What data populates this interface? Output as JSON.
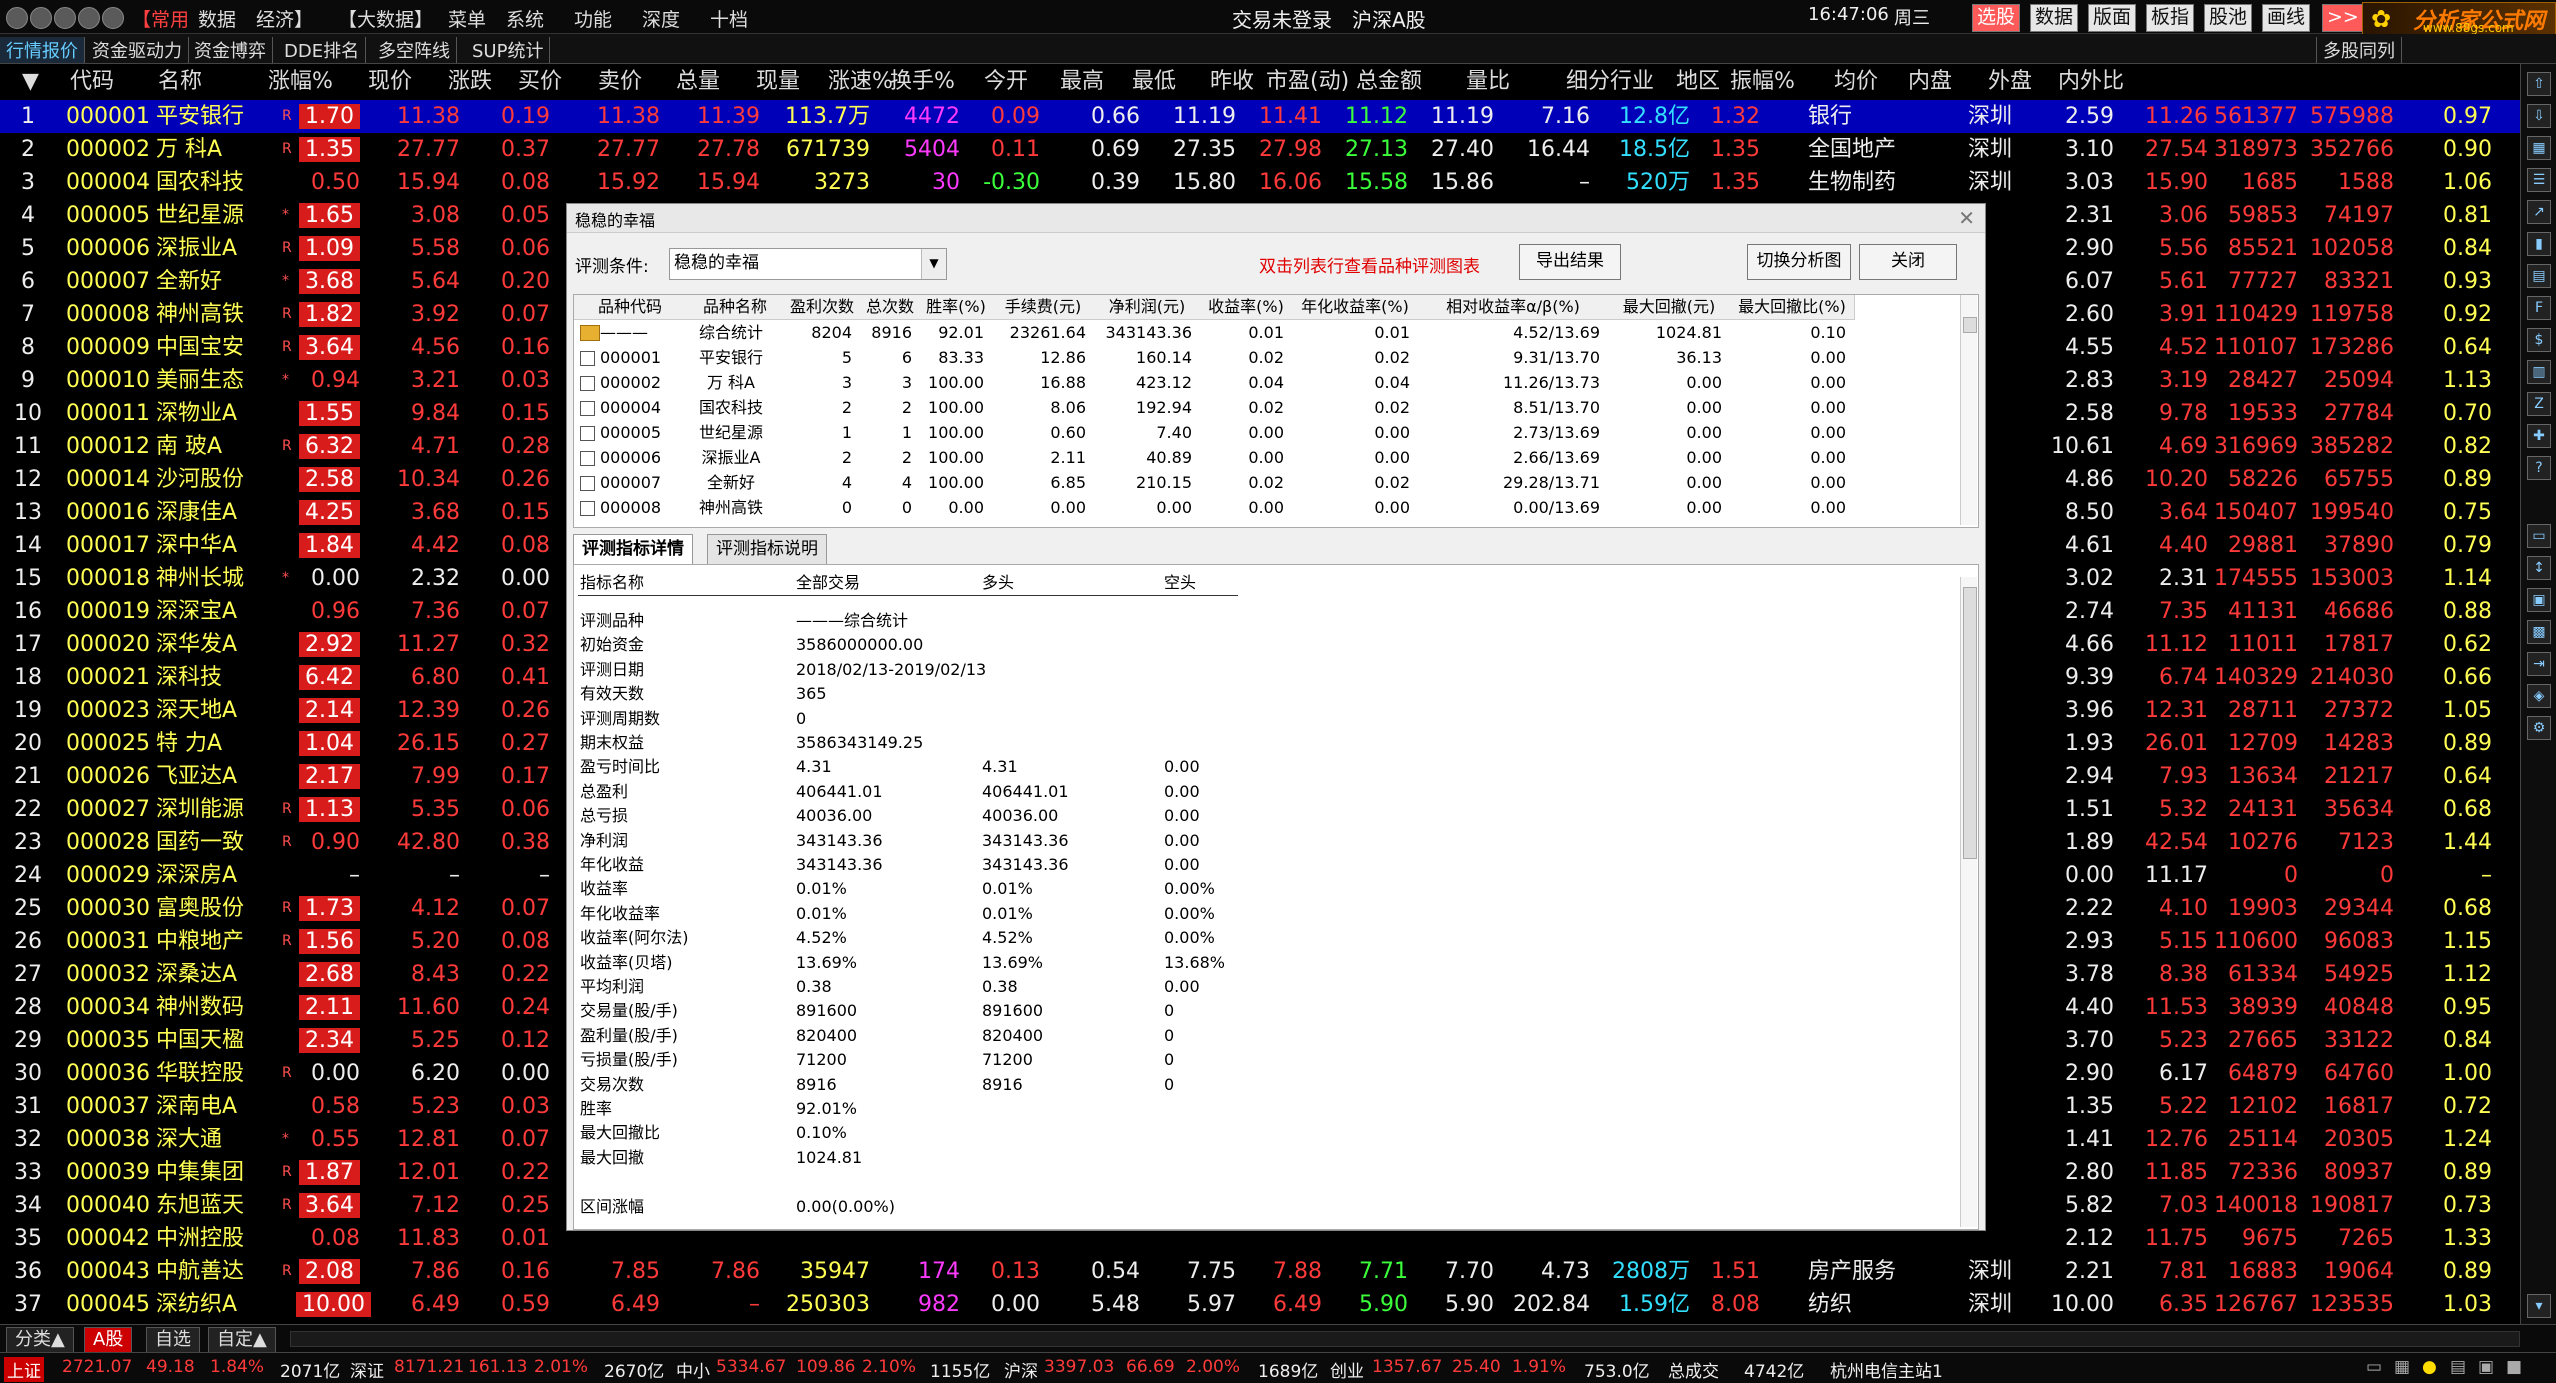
{
  "menu": {
    "items": [
      "【常用",
      "数据",
      "经济】",
      "【大数据】",
      "菜单",
      "系统",
      "功能",
      "深度",
      "十档"
    ],
    "status": "交易未登录",
    "market": "沪深A股",
    "time": "16:47:06",
    "weekday": "周三",
    "buttons": [
      "选股",
      "数据",
      "版面",
      "板指",
      "股池",
      "画线",
      ">>"
    ],
    "logo_text": "分析家公式网",
    "logo_url": "www.88gs.com"
  },
  "tabs": [
    "行情报价",
    "资金驱动力",
    "资金博弈",
    "DDE排名",
    "多空阵线",
    "SUP统计"
  ],
  "right_tabs": [
    "多股同列"
  ],
  "columns": [
    "代码",
    "名称",
    "涨幅%",
    "现价",
    "涨跌",
    "买价",
    "卖价",
    "总量",
    "现量",
    "涨速%",
    "换手%",
    "今开",
    "最高",
    "最低",
    "昨收",
    "市盈(动)",
    "总金额",
    "量比",
    "细分行业",
    "地区",
    "振幅%",
    "均价",
    "内盘",
    "外盘",
    "内外比"
  ],
  "rows": [
    [
      "1",
      "000001",
      "平安银行",
      "R",
      "1.70",
      "11.38",
      "0.19",
      "11.38",
      "11.39",
      "113.7万",
      "4472",
      "0.09",
      "0.66",
      "11.19",
      "11.41",
      "11.12",
      "11.19",
      "7.16",
      "12.8亿",
      "1.32",
      "银行",
      "深圳",
      "2.59",
      "11.26",
      "561377",
      "575988",
      "0.97"
    ],
    [
      "2",
      "000002",
      "万 科A",
      "R",
      "1.35",
      "27.77",
      "0.37",
      "27.77",
      "27.78",
      "671739",
      "5404",
      "0.11",
      "0.69",
      "27.35",
      "27.98",
      "27.13",
      "27.40",
      "16.44",
      "18.5亿",
      "1.35",
      "全国地产",
      "深圳",
      "3.10",
      "27.54",
      "318973",
      "352766",
      "0.90"
    ],
    [
      "3",
      "000004",
      "国农科技",
      "",
      "0.50",
      "15.94",
      "0.08",
      "15.92",
      "15.94",
      "3273",
      "30",
      "-0.30",
      "0.39",
      "15.80",
      "16.06",
      "15.58",
      "15.86",
      "–",
      "520万",
      "1.35",
      "生物制药",
      "深圳",
      "3.03",
      "15.90",
      "1685",
      "1588",
      "1.06"
    ],
    [
      "4",
      "000005",
      "世纪星源",
      "*",
      "1.65",
      "3.08",
      "0.05",
      "",
      "",
      "",
      "",
      "",
      "",
      "",
      "",
      "",
      "",
      "",
      "",
      "",
      "",
      "",
      "2.31",
      "3.06",
      "59853",
      "74197",
      "0.81"
    ],
    [
      "5",
      "000006",
      "深振业A",
      "R",
      "1.09",
      "5.58",
      "0.06",
      "",
      "",
      "",
      "",
      "",
      "",
      "",
      "",
      "",
      "",
      "",
      "",
      "",
      "",
      "",
      "2.90",
      "5.56",
      "85521",
      "102058",
      "0.84"
    ],
    [
      "6",
      "000007",
      "全新好",
      "*",
      "3.68",
      "5.64",
      "0.20",
      "",
      "",
      "",
      "",
      "",
      "",
      "",
      "",
      "",
      "",
      "",
      "",
      "",
      "",
      "",
      "6.07",
      "5.61",
      "77727",
      "83321",
      "0.93"
    ],
    [
      "7",
      "000008",
      "神州高铁",
      "R",
      "1.82",
      "3.92",
      "0.07",
      "",
      "",
      "",
      "",
      "",
      "",
      "",
      "",
      "",
      "",
      "",
      "",
      "",
      "",
      "",
      "2.60",
      "3.91",
      "110429",
      "119758",
      "0.92"
    ],
    [
      "8",
      "000009",
      "中国宝安",
      "R",
      "3.64",
      "4.56",
      "0.16",
      "",
      "",
      "",
      "",
      "",
      "",
      "",
      "",
      "",
      "",
      "",
      "",
      "",
      "",
      "",
      "4.55",
      "4.52",
      "110107",
      "173286",
      "0.64"
    ],
    [
      "9",
      "000010",
      "美丽生态",
      "*",
      "0.94",
      "3.21",
      "0.03",
      "",
      "",
      "",
      "",
      "",
      "",
      "",
      "",
      "",
      "",
      "",
      "",
      "",
      "",
      "",
      "2.83",
      "3.19",
      "28427",
      "25094",
      "1.13"
    ],
    [
      "10",
      "000011",
      "深物业A",
      "",
      "1.55",
      "9.84",
      "0.15",
      "",
      "",
      "",
      "",
      "",
      "",
      "",
      "",
      "",
      "",
      "",
      "",
      "",
      "",
      "",
      "2.58",
      "9.78",
      "19533",
      "27784",
      "0.70"
    ],
    [
      "11",
      "000012",
      "南 玻A",
      "R",
      "6.32",
      "4.71",
      "0.28",
      "",
      "",
      "",
      "",
      "",
      "",
      "",
      "",
      "",
      "",
      "",
      "",
      "",
      "",
      "",
      "10.61",
      "4.69",
      "316969",
      "385282",
      "0.82"
    ],
    [
      "12",
      "000014",
      "沙河股份",
      "",
      "2.58",
      "10.34",
      "0.26",
      "",
      "",
      "",
      "",
      "",
      "",
      "",
      "",
      "",
      "",
      "",
      "",
      "",
      "",
      "",
      "4.86",
      "10.20",
      "58226",
      "65755",
      "0.89"
    ],
    [
      "13",
      "000016",
      "深康佳A",
      "",
      "4.25",
      "3.68",
      "0.15",
      "",
      "",
      "",
      "",
      "",
      "",
      "",
      "",
      "",
      "",
      "",
      "",
      "",
      "",
      "",
      "8.50",
      "3.64",
      "150407",
      "199540",
      "0.75"
    ],
    [
      "14",
      "000017",
      "深中华A",
      "",
      "1.84",
      "4.42",
      "0.08",
      "",
      "",
      "",
      "",
      "",
      "",
      "",
      "",
      "",
      "",
      "",
      "",
      "",
      "",
      "",
      "4.61",
      "4.40",
      "29881",
      "37890",
      "0.79"
    ],
    [
      "15",
      "000018",
      "神州长城",
      "*",
      "0.00",
      "2.32",
      "0.00",
      "",
      "",
      "",
      "",
      "",
      "",
      "",
      "",
      "",
      "",
      "",
      "",
      "",
      "",
      "",
      "3.02",
      "2.31",
      "174555",
      "153003",
      "1.14"
    ],
    [
      "16",
      "000019",
      "深深宝A",
      "",
      "0.96",
      "7.36",
      "0.07",
      "",
      "",
      "",
      "",
      "",
      "",
      "",
      "",
      "",
      "",
      "",
      "",
      "",
      "",
      "",
      "2.74",
      "7.35",
      "41131",
      "46686",
      "0.88"
    ],
    [
      "17",
      "000020",
      "深华发A",
      "",
      "2.92",
      "11.27",
      "0.32",
      "",
      "",
      "",
      "",
      "",
      "",
      "",
      "",
      "",
      "",
      "",
      "",
      "",
      "",
      "",
      "4.66",
      "11.12",
      "11011",
      "17817",
      "0.62"
    ],
    [
      "18",
      "000021",
      "深科技",
      "",
      "6.42",
      "6.80",
      "0.41",
      "",
      "",
      "",
      "",
      "",
      "",
      "",
      "",
      "",
      "",
      "",
      "",
      "",
      "",
      "",
      "9.39",
      "6.74",
      "140329",
      "214030",
      "0.66"
    ],
    [
      "19",
      "000023",
      "深天地A",
      "",
      "2.14",
      "12.39",
      "0.26",
      "",
      "",
      "",
      "",
      "",
      "",
      "",
      "",
      "",
      "",
      "",
      "",
      "",
      "",
      "",
      "3.96",
      "12.31",
      "28711",
      "27372",
      "1.05"
    ],
    [
      "20",
      "000025",
      "特 力A",
      "",
      "1.04",
      "26.15",
      "0.27",
      "",
      "",
      "",
      "",
      "",
      "",
      "",
      "",
      "",
      "",
      "",
      "",
      "",
      "",
      "",
      "1.93",
      "26.01",
      "12709",
      "14283",
      "0.89"
    ],
    [
      "21",
      "000026",
      "飞亚达A",
      "",
      "2.17",
      "7.99",
      "0.17",
      "",
      "",
      "",
      "",
      "",
      "",
      "",
      "",
      "",
      "",
      "",
      "",
      "",
      "",
      "",
      "2.94",
      "7.93",
      "13634",
      "21217",
      "0.64"
    ],
    [
      "22",
      "000027",
      "深圳能源",
      "R",
      "1.13",
      "5.35",
      "0.06",
      "",
      "",
      "",
      "",
      "",
      "",
      "",
      "",
      "",
      "",
      "",
      "",
      "",
      "",
      "",
      "1.51",
      "5.32",
      "24131",
      "35634",
      "0.68"
    ],
    [
      "23",
      "000028",
      "国药一致",
      "R",
      "0.90",
      "42.80",
      "0.38",
      "",
      "",
      "",
      "",
      "",
      "",
      "",
      "",
      "",
      "",
      "",
      "",
      "",
      "",
      "",
      "1.89",
      "42.54",
      "10276",
      "7123",
      "1.44"
    ],
    [
      "24",
      "000029",
      "深深房A",
      "",
      "–",
      "–",
      "–",
      "",
      "",
      "",
      "",
      "",
      "",
      "",
      "",
      "",
      "",
      "",
      "",
      "",
      "",
      "",
      "0.00",
      "11.17",
      "0",
      "0",
      "–"
    ],
    [
      "25",
      "000030",
      "富奥股份",
      "R",
      "1.73",
      "4.12",
      "0.07",
      "",
      "",
      "",
      "",
      "",
      "",
      "",
      "",
      "",
      "",
      "",
      "",
      "",
      "",
      "",
      "2.22",
      "4.10",
      "19903",
      "29344",
      "0.68"
    ],
    [
      "26",
      "000031",
      "中粮地产",
      "R",
      "1.56",
      "5.20",
      "0.08",
      "",
      "",
      "",
      "",
      "",
      "",
      "",
      "",
      "",
      "",
      "",
      "",
      "",
      "",
      "",
      "2.93",
      "5.15",
      "110600",
      "96083",
      "1.15"
    ],
    [
      "27",
      "000032",
      "深桑达A",
      "",
      "2.68",
      "8.43",
      "0.22",
      "",
      "",
      "",
      "",
      "",
      "",
      "",
      "",
      "",
      "",
      "",
      "",
      "",
      "",
      "",
      "3.78",
      "8.38",
      "61334",
      "54925",
      "1.12"
    ],
    [
      "28",
      "000034",
      "神州数码",
      "",
      "2.11",
      "11.60",
      "0.24",
      "",
      "",
      "",
      "",
      "",
      "",
      "",
      "",
      "",
      "",
      "",
      "",
      "",
      "",
      "",
      "4.40",
      "11.53",
      "38939",
      "40848",
      "0.95"
    ],
    [
      "29",
      "000035",
      "中国天楹",
      "",
      "2.34",
      "5.25",
      "0.12",
      "",
      "",
      "",
      "",
      "",
      "",
      "",
      "",
      "",
      "",
      "",
      "",
      "",
      "",
      "",
      "3.70",
      "5.23",
      "27665",
      "33122",
      "0.84"
    ],
    [
      "30",
      "000036",
      "华联控股",
      "R",
      "0.00",
      "6.20",
      "0.00",
      "",
      "",
      "",
      "",
      "",
      "",
      "",
      "",
      "",
      "",
      "",
      "",
      "",
      "",
      "",
      "2.90",
      "6.17",
      "64879",
      "64760",
      "1.00"
    ],
    [
      "31",
      "000037",
      "深南电A",
      "",
      "0.58",
      "5.23",
      "0.03",
      "",
      "",
      "",
      "",
      "",
      "",
      "",
      "",
      "",
      "",
      "",
      "",
      "",
      "",
      "",
      "1.35",
      "5.22",
      "12102",
      "16817",
      "0.72"
    ],
    [
      "32",
      "000038",
      "深大通",
      "*",
      "0.55",
      "12.81",
      "0.07",
      "",
      "",
      "",
      "",
      "",
      "",
      "",
      "",
      "",
      "",
      "",
      "",
      "",
      "",
      "",
      "1.41",
      "12.76",
      "25114",
      "20305",
      "1.24"
    ],
    [
      "33",
      "000039",
      "中集集团",
      "R",
      "1.87",
      "12.01",
      "0.22",
      "",
      "",
      "",
      "",
      "",
      "",
      "",
      "",
      "",
      "",
      "",
      "",
      "",
      "",
      "",
      "2.80",
      "11.85",
      "72336",
      "80937",
      "0.89"
    ],
    [
      "34",
      "000040",
      "东旭蓝天",
      "R",
      "3.64",
      "7.12",
      "0.25",
      "",
      "",
      "",
      "",
      "",
      "",
      "",
      "",
      "",
      "",
      "",
      "",
      "",
      "",
      "",
      "5.82",
      "7.03",
      "140018",
      "190817",
      "0.73"
    ],
    [
      "35",
      "000042",
      "中洲控股",
      "",
      "0.08",
      "11.83",
      "0.01",
      "",
      "",
      "",
      "",
      "",
      "",
      "",
      "",
      "",
      "",
      "",
      "",
      "",
      "",
      "",
      "2.12",
      "11.75",
      "9675",
      "7265",
      "1.33"
    ],
    [
      "36",
      "000043",
      "中航善达",
      "R",
      "2.08",
      "7.86",
      "0.16",
      "7.85",
      "7.86",
      "35947",
      "174",
      "0.13",
      "0.54",
      "7.75",
      "7.88",
      "7.71",
      "7.70",
      "4.73",
      "2808万",
      "1.51",
      "房产服务",
      "深圳",
      "2.21",
      "7.81",
      "16883",
      "19064",
      "0.89"
    ],
    [
      "37",
      "000045",
      "深纺织A",
      "",
      "10.00",
      "6.49",
      "0.59",
      "6.49",
      "–",
      "250303",
      "982",
      "0.00",
      "5.48",
      "5.97",
      "6.49",
      "5.90",
      "5.90",
      "202.84",
      "1.59亿",
      "8.08",
      "纺织",
      "深圳",
      "10.00",
      "6.35",
      "126767",
      "123535",
      "1.03"
    ]
  ],
  "bottom_tabs": [
    "分类▲",
    "A股",
    "自选",
    "自定▲"
  ],
  "status_bar": {
    "sh_label": "上证",
    "sh_val": "2721.07",
    "sh_chg": "49.18",
    "sh_pct": "1.84%",
    "sh_amt": "2071亿",
    "sz_label": "深证",
    "sz_val": "8171.21",
    "sz_chg": "161.13",
    "sz_pct": "2.01%",
    "sz_amt": "2670亿",
    "zx_label": "中小",
    "zx_val": "5334.67",
    "zx_chg": "109.86",
    "zx_pct": "2.10%",
    "zx_amt": "1155亿",
    "hs_label": "沪深",
    "hs_val": "3397.03",
    "hs_chg": "66.69",
    "hs_pct": "2.00%",
    "hs_amt": "1689亿",
    "cy_label": "创业",
    "cy_val": "1357.67",
    "cy_chg": "25.40",
    "cy_pct": "1.91%",
    "cy_amt": "753.0亿",
    "total_label": "总成交",
    "total_val": "4742亿",
    "site": "杭州电信主站1"
  },
  "dialog": {
    "title": "稳稳的幸福",
    "cond_label": "评测条件:",
    "cond_value": "稳稳的幸福",
    "hint": "双击列表行查看品种评测图表",
    "export_btn": "导出结果",
    "switch_btn": "切换分析图",
    "close_btn": "关闭",
    "list_headers": [
      "品种代码",
      "品种名称",
      "盈利次数",
      "总次数",
      "胜率(%)",
      "手续费(元)",
      "净利润(元)",
      "收益率(%)",
      "年化收益率(%)",
      "相对收益率α/β(%)",
      "最大回撤(元)",
      "最大回撤比(%)"
    ],
    "list_rows": [
      [
        "———",
        "综合统计",
        "8204",
        "8916",
        "92.01",
        "23261.64",
        "343143.36",
        "0.01",
        "0.01",
        "4.52/13.69",
        "1024.81",
        "0.10"
      ],
      [
        "000001",
        "平安银行",
        "5",
        "6",
        "83.33",
        "12.86",
        "160.14",
        "0.02",
        "0.02",
        "9.31/13.70",
        "36.13",
        "0.00"
      ],
      [
        "000002",
        "万 科A",
        "3",
        "3",
        "100.00",
        "16.88",
        "423.12",
        "0.04",
        "0.04",
        "11.26/13.73",
        "0.00",
        "0.00"
      ],
      [
        "000004",
        "国农科技",
        "2",
        "2",
        "100.00",
        "8.06",
        "192.94",
        "0.02",
        "0.02",
        "8.51/13.70",
        "0.00",
        "0.00"
      ],
      [
        "000005",
        "世纪星源",
        "1",
        "1",
        "100.00",
        "0.60",
        "7.40",
        "0.00",
        "0.00",
        "2.73/13.69",
        "0.00",
        "0.00"
      ],
      [
        "000006",
        "深振业A",
        "2",
        "2",
        "100.00",
        "2.11",
        "40.89",
        "0.00",
        "0.00",
        "2.66/13.69",
        "0.00",
        "0.00"
      ],
      [
        "000007",
        "全新好",
        "4",
        "4",
        "100.00",
        "6.85",
        "210.15",
        "0.02",
        "0.02",
        "29.28/13.71",
        "0.00",
        "0.00"
      ],
      [
        "000008",
        "神州高铁",
        "0",
        "0",
        "0.00",
        "0.00",
        "0.00",
        "0.00",
        "0.00",
        "0.00/13.69",
        "0.00",
        "0.00"
      ]
    ],
    "tabs": [
      "评测指标详情",
      "评测指标说明"
    ],
    "detail_headers": [
      "指标名称",
      "全部交易",
      "多头",
      "空头"
    ],
    "detail_rows": [
      [
        "评测品种",
        "———综合统计",
        "",
        ""
      ],
      [
        "初始资金",
        "3586000000.00",
        "",
        ""
      ],
      [
        "评测日期",
        "2018/02/13-2019/02/13",
        "",
        ""
      ],
      [
        "有效天数",
        "365",
        "",
        ""
      ],
      [
        "评测周期数",
        "0",
        "",
        ""
      ],
      [
        "期末权益",
        "3586343149.25",
        "",
        ""
      ],
      [
        "盈亏时间比",
        "4.31",
        "4.31",
        "0.00"
      ],
      [
        "总盈利",
        "406441.01",
        "406441.01",
        "0.00"
      ],
      [
        "总亏损",
        "40036.00",
        "40036.00",
        "0.00"
      ],
      [
        "净利润",
        "343143.36",
        "343143.36",
        "0.00"
      ],
      [
        "年化收益",
        "343143.36",
        "343143.36",
        "0.00"
      ],
      [
        "收益率",
        "0.01%",
        "0.01%",
        "0.00%"
      ],
      [
        "年化收益率",
        "0.01%",
        "0.01%",
        "0.00%"
      ],
      [
        "收益率(阿尔法)",
        "4.52%",
        "4.52%",
        "0.00%"
      ],
      [
        "收益率(贝塔)",
        "13.69%",
        "13.69%",
        "13.68%"
      ],
      [
        "平均利润",
        "0.38",
        "0.38",
        "0.00"
      ],
      [
        "交易量(股/手)",
        "891600",
        "891600",
        "0"
      ],
      [
        "盈利量(股/手)",
        "820400",
        "820400",
        "0"
      ],
      [
        "亏损量(股/手)",
        "71200",
        "71200",
        "0"
      ],
      [
        "交易次数",
        "8916",
        "8916",
        "0"
      ],
      [
        "胜率",
        "92.01%",
        "",
        ""
      ],
      [
        "最大回撤比",
        "0.10%",
        "",
        ""
      ],
      [
        "最大回撤",
        "1024.81",
        "",
        ""
      ],
      [
        "",
        "",
        "",
        ""
      ],
      [
        "区间涨幅",
        "0.00(0.00%)",
        "",
        ""
      ]
    ]
  },
  "colors": {
    "selected_row": "#0000b8",
    "up": "#ff3a3a",
    "down": "#3cff3c",
    "code": "#ffff54",
    "pill": "#d81c1c"
  }
}
